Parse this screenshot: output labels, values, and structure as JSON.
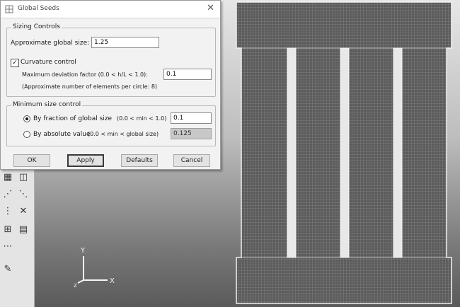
{
  "dialog": {
    "title": "Global Seeds",
    "sizing_controls_title": "Sizing Controls",
    "approx_size_label": "Approximate global size:",
    "approx_size_value": "1.25",
    "curvature_label": "Curvature control",
    "curvature_checked": true,
    "max_dev_label": "Maximum deviation factor (0.0 < h/L < 1.0):",
    "max_dev_value": "0.1",
    "approx_elements_note": "(Approximate number of elements per circle: 8)",
    "min_size_title": "Minimum size control",
    "by_fraction_label": "By fraction of global size",
    "by_fraction_range": "(0.0 < min < 1.0)",
    "by_fraction_value": "0.1",
    "by_absolute_label": "By absolute value",
    "by_absolute_range": "(0.0 < min < global size)",
    "by_absolute_value": "0.125",
    "selected_min_option": "by_fraction",
    "buttons": {
      "ok": "OK",
      "apply": "Apply",
      "defaults": "Defaults",
      "cancel": "Cancel"
    }
  },
  "triad": {
    "y_label": "Y",
    "x_label": "X",
    "z_label": "Z"
  },
  "toolbox": {
    "icons": [
      "seed-part-icon",
      "seed-edge-icon",
      "mesh-region-icon",
      "mesh-part-icon",
      "assign-element-icon",
      "verify-mesh-icon",
      "partition-icon",
      "virtual-topology-icon",
      "edit-mesh-icon"
    ]
  },
  "colors": {
    "mesh_fill": "#5b5b5b",
    "mesh_line": "#7e7e7e",
    "mesh_outline": "#f0f0f0",
    "dialog_bg": "#f2f2f2"
  }
}
